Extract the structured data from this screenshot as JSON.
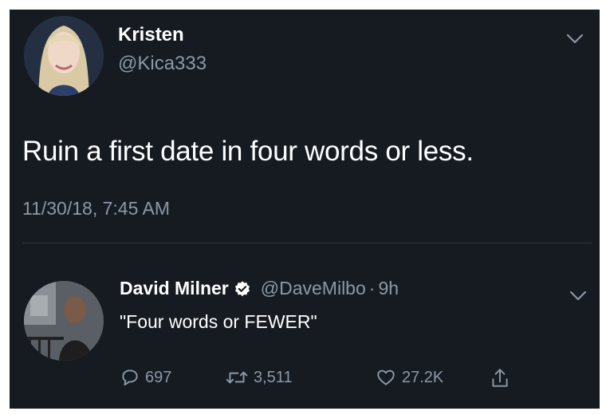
{
  "main_tweet": {
    "display_name": "Kristen",
    "handle": "@Kica333",
    "text": "Ruin a first date in four words or less.",
    "timestamp": "11/30/18, 7:45 AM",
    "menu_icon": "chevron-down-icon"
  },
  "reply_tweet": {
    "display_name": "David Milner",
    "verified_icon": "verified-badge-icon",
    "handle": "@DaveMilbo",
    "separator": "·",
    "age": "9h",
    "text": "\"Four words or FEWER\"",
    "menu_icon": "chevron-down-icon",
    "actions": {
      "reply_count": "697",
      "retweet_count": "3,511",
      "like_count": "27.2K",
      "icons": [
        "reply-icon",
        "retweet-icon",
        "like-icon",
        "share-icon"
      ]
    }
  },
  "colors": {
    "background": "#161b22",
    "primary_text": "#ffffff",
    "secondary_text": "#8b98a5",
    "verified_badge": "#ffffff"
  }
}
